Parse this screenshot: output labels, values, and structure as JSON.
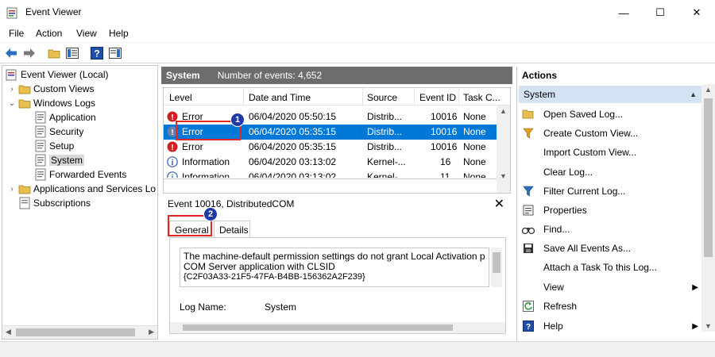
{
  "window": {
    "title": "Event Viewer",
    "minimize": "—",
    "maximize": "☐",
    "close": "✕"
  },
  "menu": [
    "File",
    "Action",
    "View",
    "Help"
  ],
  "tree": [
    {
      "label": "Event Viewer (Local)",
      "twisty": ""
    },
    {
      "label": "Custom Views",
      "twisty": "›"
    },
    {
      "label": "Windows Logs",
      "twisty": "⌄"
    },
    {
      "label": "Application",
      "twisty": ""
    },
    {
      "label": "Security",
      "twisty": ""
    },
    {
      "label": "Setup",
      "twisty": ""
    },
    {
      "label": "System",
      "twisty": ""
    },
    {
      "label": "Forwarded Events",
      "twisty": ""
    },
    {
      "label": "Applications and Services Lo",
      "twisty": "›"
    },
    {
      "label": "Subscriptions",
      "twisty": ""
    }
  ],
  "events_pane": {
    "log_name": "System",
    "count_label": "Number of events: 4,652",
    "columns": [
      "Level",
      "Date and Time",
      "Source",
      "Event ID",
      "Task C..."
    ],
    "rows": [
      {
        "level": "Error",
        "datetime": "06/04/2020 05:50:15",
        "source": "Distrib...",
        "event_id": "10016",
        "task": "None",
        "icon": "error-icon"
      },
      {
        "level": "Error",
        "datetime": "06/04/2020 05:35:15",
        "source": "Distrib...",
        "event_id": "10016",
        "task": "None",
        "icon": "error-icon",
        "selected": true
      },
      {
        "level": "Error",
        "datetime": "06/04/2020 05:35:15",
        "source": "Distrib...",
        "event_id": "10016",
        "task": "None",
        "icon": "error-icon"
      },
      {
        "level": "Information",
        "datetime": "06/04/2020 03:13:02",
        "source": "Kernel-...",
        "event_id": "16",
        "task": "None",
        "icon": "info-icon"
      },
      {
        "level": "Information",
        "datetime": "06/04/2020 03:13:02",
        "source": "Kernel-...",
        "event_id": "11",
        "task": "None",
        "icon": "info-icon"
      }
    ]
  },
  "detail": {
    "title": "Event 10016, DistributedCOM",
    "tabs": [
      "General",
      "Details"
    ],
    "description_lines": [
      "The machine-default permission settings do not grant Local Activation p",
      "COM Server application with CLSID",
      "{C2F03A33-21F5-47FA-B4BB-156362A2F239}"
    ],
    "log_name_label": "Log Name:",
    "log_name_value": "System"
  },
  "actions": {
    "header": "Actions",
    "section": "System",
    "items": [
      {
        "label": "Open Saved Log...",
        "icon": "folder-open-icon"
      },
      {
        "label": "Create Custom View...",
        "icon": "filter-icon"
      },
      {
        "label": "Import Custom View...",
        "icon": ""
      },
      {
        "label": "Clear Log...",
        "icon": ""
      },
      {
        "label": "Filter Current Log...",
        "icon": "filter-icon"
      },
      {
        "label": "Properties",
        "icon": "properties-icon"
      },
      {
        "label": "Find...",
        "icon": "binoculars-icon"
      },
      {
        "label": "Save All Events As...",
        "icon": "save-icon"
      },
      {
        "label": "Attach a Task To this Log...",
        "icon": ""
      },
      {
        "label": "View",
        "icon": "",
        "submenu": true
      },
      {
        "label": "Refresh",
        "icon": "refresh-icon"
      },
      {
        "label": "Help",
        "icon": "help-icon",
        "submenu": true
      }
    ]
  },
  "callouts": [
    "1",
    "2"
  ],
  "colors": {
    "selection": "#0078d7",
    "callout_border": "#e32626",
    "badge": "#1d3aa8",
    "header_bar": "#6d6d6d"
  }
}
